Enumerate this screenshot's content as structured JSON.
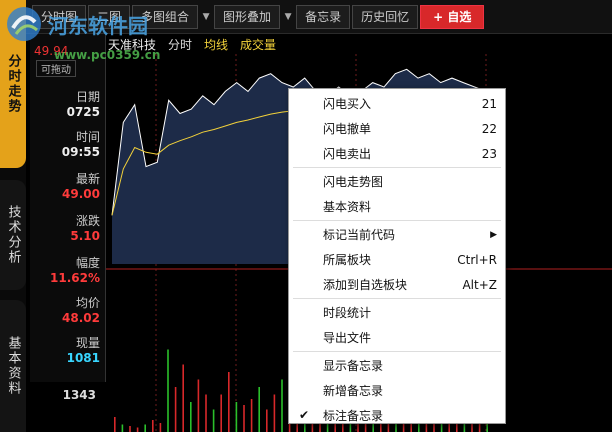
{
  "vtabs": {
    "tab1": "分时走势",
    "tab2": "技术分析",
    "tab3": "基本资料"
  },
  "toolbar": {
    "btn1": "分时图",
    "btn2": "二图",
    "btn3": "多图组合",
    "btn4": "图形叠加",
    "btn5": "备忘录",
    "btn6": "历史回忆",
    "fav": "+ 自选",
    "dropdown": "▼"
  },
  "info": {
    "price_top": "49.94",
    "draggable": "可拖动",
    "date_label": "日期",
    "date_value": "0725",
    "time_label": "时间",
    "time_value": "09:55",
    "latest_label": "最新",
    "latest_value": "49.00",
    "change_label": "涨跌",
    "change_value": "5.10",
    "pct_label": "幅度",
    "pct_value": "11.62%",
    "avg_label": "均价",
    "avg_value": "48.02",
    "vol_label": "现量",
    "vol_value": "1081",
    "vol_bottom": "1343"
  },
  "legend": {
    "name": "天准科技",
    "fenshi": "分时",
    "avg": "均线",
    "vol": "成交量"
  },
  "watermark": {
    "text": "河东软件园",
    "url": "www.pc0359.cn"
  },
  "menu": {
    "i1": "闪电买入",
    "i1_sc": "21",
    "i2": "闪电撤单",
    "i2_sc": "22",
    "i3": "闪电卖出",
    "i3_sc": "23",
    "i4": "闪电走势图",
    "i5": "基本资料",
    "i6": "标记当前代码",
    "i7": "所属板块",
    "i7_sc": "Ctrl+R",
    "i8": "添加到自选板块",
    "i8_sc": "Alt+Z",
    "i9": "时段统计",
    "i10": "导出文件",
    "i11": "显示备忘录",
    "i12": "新增备忘录",
    "i13": "标注备忘录",
    "check": "✔",
    "submenu_arrow": "▶"
  },
  "colors": {
    "accent_tab": "#e4a21a",
    "price_line": "#ffffff",
    "avg_line": "#f3d23a",
    "vol_up": "#d8282a",
    "vol_down": "#2bc02b",
    "fav_button": "#d8282a"
  },
  "series": {
    "price": [
      46.6,
      48.7,
      49.1,
      47.7,
      47.8,
      49.2,
      48.9,
      49.0,
      49.3,
      49.1,
      49.4,
      49.6,
      49.4,
      49.7,
      49.8,
      49.6,
      49.5,
      49.7,
      49.4,
      49.3,
      49.5,
      49.3,
      49.4,
      49.6,
      49.5,
      49.8,
      49.9,
      49.7,
      49.8,
      49.6,
      49.7,
      49.6,
      49.5,
      49.4
    ],
    "volumes": [
      0.1,
      0.05,
      0.04,
      0.03,
      0.05,
      0.08,
      0.06,
      0.55,
      0.3,
      0.45,
      0.2,
      0.35,
      0.25,
      0.15,
      0.25,
      0.4,
      0.2,
      0.18,
      0.22,
      0.3,
      0.15,
      0.25,
      0.35,
      0.12,
      0.2,
      0.3,
      0.15,
      0.1,
      0.22,
      0.18,
      0.35,
      0.25,
      0.12,
      0.2,
      0.15,
      0.3,
      0.22,
      0.1,
      0.18,
      0.25,
      0.15,
      0.12,
      0.28,
      0.2,
      0.35,
      0.15,
      0.22,
      0.18,
      0.12,
      0.25
    ]
  }
}
